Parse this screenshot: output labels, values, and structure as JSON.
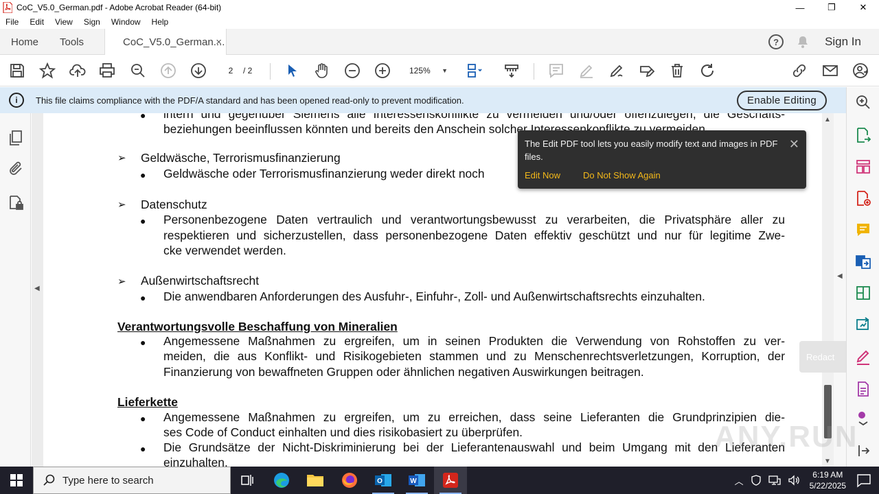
{
  "window": {
    "title": "CoC_V5.0_German.pdf - Adobe Acrobat Reader (64-bit)",
    "minimize": "—",
    "maximize": "❐",
    "close": "✕"
  },
  "menubar": [
    "File",
    "Edit",
    "View",
    "Sign",
    "Window",
    "Help"
  ],
  "tabs": {
    "home": "Home",
    "tools": "Tools",
    "document": "CoC_V5.0_German....",
    "document_close": "×",
    "help": "?",
    "sign_in": "Sign In"
  },
  "toolbar": {
    "page_current": "2",
    "page_total": "/ 2",
    "zoom": "125%",
    "icons": [
      "save-icon",
      "bookmark-star-icon",
      "upload-icon",
      "print-icon",
      "zoom-search-icon",
      "page-up-icon",
      "page-down-icon",
      "select-arrow-icon",
      "hand-icon",
      "zoom-out-icon",
      "zoom-in-icon",
      "page-view-icon",
      "scroll-mode-icon",
      "comment-icon",
      "highlight-icon",
      "sign-icon",
      "edit-icon",
      "delete-icon",
      "rotate-icon",
      "link-icon",
      "email-icon",
      "share-user-icon"
    ]
  },
  "infobar": {
    "message": "This file claims compliance with the PDF/A standard and has been opened read-only to prevent modification.",
    "button": "Enable Editing"
  },
  "popup": {
    "text": "The Edit PDF tool lets you easily modify text and images in PDF files.",
    "edit_now": "Edit Now",
    "dont_show": "Do Not Show Again",
    "close": "✕"
  },
  "redact": {
    "label": "Redact"
  },
  "document": {
    "lines": [
      {
        "type": "bullet-text",
        "text": "intern und gegenüber Siemens alle Interessenskonflikte zu vermeiden und/oder offenzulegen, die Geschäfts-"
      },
      {
        "type": "text",
        "text": "beziehungen beeinflussen könnten und bereits den Anschein solcher Interessenkonflikte zu vermeiden."
      },
      {
        "type": "arrow",
        "text": "Geldwäsche, Terrorismusfinanzierung"
      },
      {
        "type": "bullet",
        "text": "Geldwäsche oder Terrorismusfinanzierung weder direkt noch"
      },
      {
        "type": "arrow",
        "text": "Datenschutz"
      },
      {
        "type": "bullet",
        "text": "Personenbezogene Daten vertraulich und verantwortungsbewusst zu verarbeiten, die Privatsphäre aller zu"
      },
      {
        "type": "text",
        "text": "respektieren und sicherzustellen, dass personenbezogene Daten effektiv geschützt und nur für legitime Zwe-"
      },
      {
        "type": "text",
        "text": "cke verwendet werden."
      },
      {
        "type": "arrow",
        "text": "Außenwirtschaftsrecht"
      },
      {
        "type": "bullet",
        "text": "Die anwendbaren Anforderungen des Ausfuhr-, Einfuhr-, Zoll- und Außenwirtschaftsrechts einzuhalten."
      },
      {
        "type": "heading",
        "text": "Verantwortungsvolle Beschaffung von Mineralien"
      },
      {
        "type": "bullet",
        "text": "Angemessene Maßnahmen zu ergreifen, um in seinen Produkten die Verwendung von Rohstoffen zu ver-"
      },
      {
        "type": "text",
        "text": "meiden, die aus Konflikt- und Risikogebieten stammen und zu Menschenrechtsverletzungen, Korruption, der"
      },
      {
        "type": "text",
        "text": "Finanzierung von bewaffneten Gruppen oder ähnlichen negativen Auswirkungen beitragen."
      },
      {
        "type": "heading",
        "text": "Lieferkette"
      },
      {
        "type": "bullet",
        "text": "Angemessene Maßnahmen zu ergreifen, um zu erreichen, dass seine Lieferanten die Grundprinzipien die-"
      },
      {
        "type": "text",
        "text": "ses Code of Conduct einhalten und dies risikobasiert zu überprüfen."
      },
      {
        "type": "bullet",
        "text": "Die Grundsätze der Nicht-Diskriminierung bei der Lieferantenauswahl und beim Umgang mit den Lieferanten"
      },
      {
        "type": "text",
        "text": "einzuhalten."
      }
    ]
  },
  "watermark": "ANY.RUN",
  "taskbar": {
    "search_placeholder": "Type here to search",
    "apps": [
      "task-view-icon",
      "edge-icon",
      "file-explorer-icon",
      "firefox-icon",
      "outlook-icon",
      "word-icon",
      "acrobat-icon"
    ],
    "time": "6:19 AM",
    "date": "5/22/2025"
  },
  "colors": {
    "infobar_bg": "#dcebf8",
    "popup_bg": "#2f2f2f",
    "popup_link": "#f3b81a",
    "taskbar_bg": "#1f1f2a",
    "acrobat_red": "#d4261c"
  }
}
